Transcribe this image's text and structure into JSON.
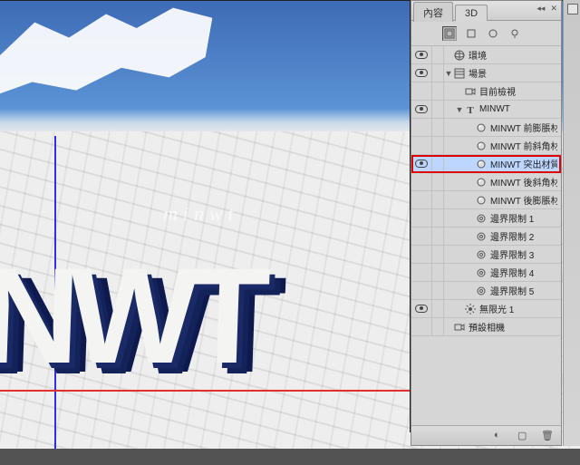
{
  "tabs": {
    "properties": "內容",
    "threeD": "3D"
  },
  "canvas_text": "NWT",
  "watermark": "minwt",
  "filters": [
    "scene",
    "mesh",
    "material",
    "light"
  ],
  "tree": [
    {
      "depth": 0,
      "vis": true,
      "twisty": "",
      "icon": "env",
      "label": "環境"
    },
    {
      "depth": 0,
      "vis": true,
      "twisty": "▼",
      "icon": "scene",
      "label": "場景"
    },
    {
      "depth": 1,
      "vis": false,
      "twisty": "",
      "icon": "cam",
      "label": "目前檢視"
    },
    {
      "depth": 1,
      "vis": true,
      "twisty": "▼",
      "icon": "mesh",
      "label": "MINWT"
    },
    {
      "depth": 2,
      "vis": false,
      "twisty": "",
      "icon": "mat",
      "label": "MINWT 前膨脹材質"
    },
    {
      "depth": 2,
      "vis": false,
      "twisty": "",
      "icon": "mat",
      "label": "MINWT 前斜角材質"
    },
    {
      "depth": 2,
      "vis": true,
      "twisty": "",
      "icon": "mat",
      "label": "MINWT 突出材質",
      "sel": true,
      "hl": true
    },
    {
      "depth": 2,
      "vis": false,
      "twisty": "",
      "icon": "mat",
      "label": "MINWT 後斜角材質"
    },
    {
      "depth": 2,
      "vis": false,
      "twisty": "",
      "icon": "mat",
      "label": "MINWT 後膨脹材質"
    },
    {
      "depth": 2,
      "vis": false,
      "twisty": "",
      "icon": "con",
      "label": "邊界限制 1"
    },
    {
      "depth": 2,
      "vis": false,
      "twisty": "",
      "icon": "con",
      "label": "邊界限制 2"
    },
    {
      "depth": 2,
      "vis": false,
      "twisty": "",
      "icon": "con",
      "label": "邊界限制 3"
    },
    {
      "depth": 2,
      "vis": false,
      "twisty": "",
      "icon": "con",
      "label": "邊界限制 4"
    },
    {
      "depth": 2,
      "vis": false,
      "twisty": "",
      "icon": "con",
      "label": "邊界限制 5"
    },
    {
      "depth": 1,
      "vis": true,
      "twisty": "",
      "icon": "light",
      "label": "無限光 1"
    },
    {
      "depth": 0,
      "vis": false,
      "twisty": "",
      "icon": "cam",
      "label": "預設相機"
    }
  ]
}
